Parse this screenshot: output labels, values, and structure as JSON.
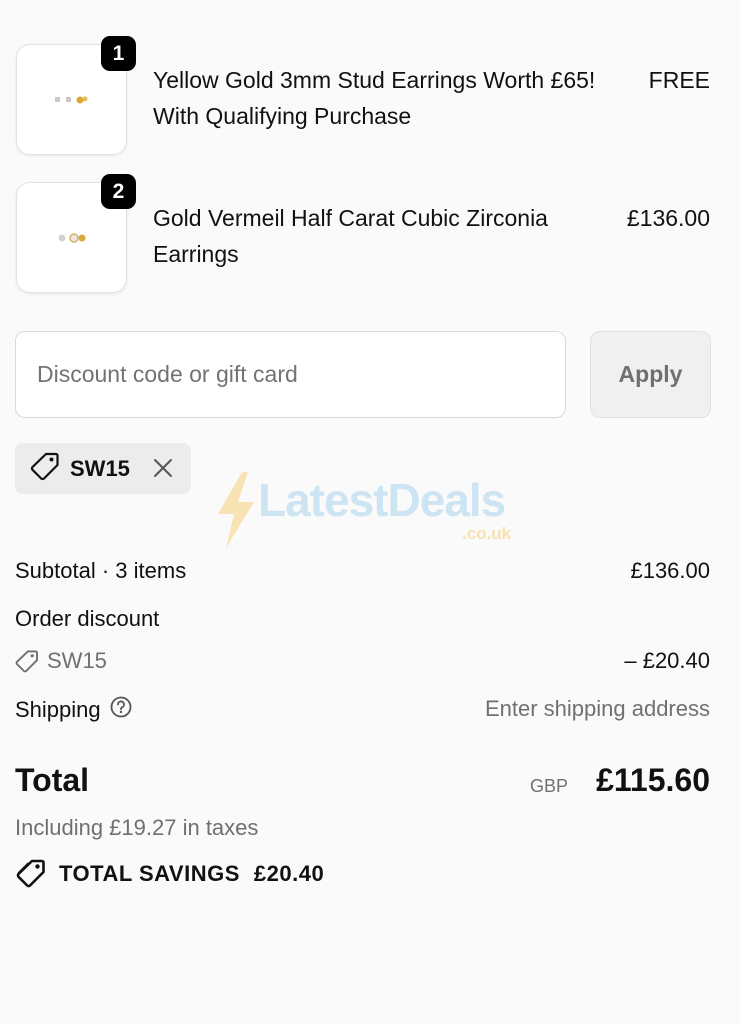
{
  "items": [
    {
      "quantity": "1",
      "name": "Yellow Gold 3mm Stud Earrings Worth £65! With Qualifying Purchase",
      "price": "FREE",
      "image_icon": "stud-earrings-icon"
    },
    {
      "quantity": "2",
      "name": "Gold Vermeil Half Carat Cubic Zirconia Earrings",
      "price": "£136.00",
      "image_icon": "cz-earrings-icon"
    }
  ],
  "discount": {
    "placeholder": "Discount code or gift card",
    "apply_label": "Apply",
    "applied_code": "SW15"
  },
  "watermark": {
    "text": "LatestDeals",
    "sub": ".co.uk"
  },
  "summary": {
    "subtotal_label": "Subtotal · 3 items",
    "subtotal_value": "£136.00",
    "order_discount_label": "Order discount",
    "discount_code": "SW15",
    "discount_value": "– £20.40",
    "shipping_label": "Shipping",
    "shipping_value": "Enter shipping address",
    "total_label": "Total",
    "currency": "GBP",
    "total_value": "£115.60",
    "taxes": "Including £19.27 in taxes",
    "savings_label": "TOTAL SAVINGS",
    "savings_value": "£20.40"
  },
  "colors": {
    "background": "#fafafa",
    "muted_text": "#707070",
    "badge": "#000000"
  }
}
